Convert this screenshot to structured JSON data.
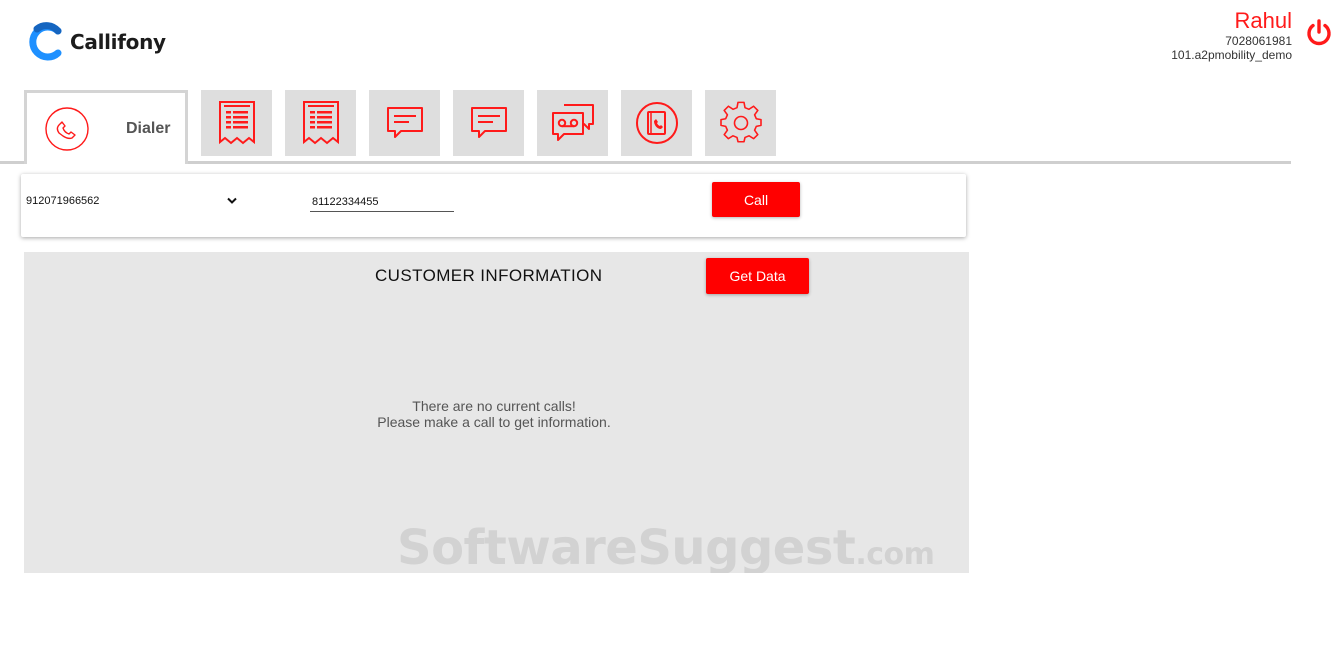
{
  "app": {
    "brand": "Callifony"
  },
  "user": {
    "name": "Rahul",
    "phone": "7028061981",
    "account": "101.a2pmobility_demo"
  },
  "tabs": [
    {
      "label": "Dialer",
      "icon": "phone-icon",
      "active": true
    },
    {
      "icon": "receipt-icon"
    },
    {
      "icon": "receipt-icon"
    },
    {
      "icon": "chat-message-icon"
    },
    {
      "icon": "chat-message-icon"
    },
    {
      "icon": "voicemail-chat-icon"
    },
    {
      "icon": "phonebook-icon"
    },
    {
      "icon": "gear-icon"
    }
  ],
  "dialer": {
    "caller_id": "912071966562",
    "number": "81122334455",
    "call_label": "Call"
  },
  "customer": {
    "title": "CUSTOMER INFORMATION",
    "get_data_label": "Get Data",
    "empty_line1": "There are no current calls!",
    "empty_line2": "Please make a call to get information."
  },
  "watermark": {
    "text": "SoftwareSuggest",
    "suffix": ".com"
  },
  "colors": {
    "accent": "#ff0000",
    "tab_bg": "#dedede",
    "panel_bg": "#e7e7e7"
  }
}
